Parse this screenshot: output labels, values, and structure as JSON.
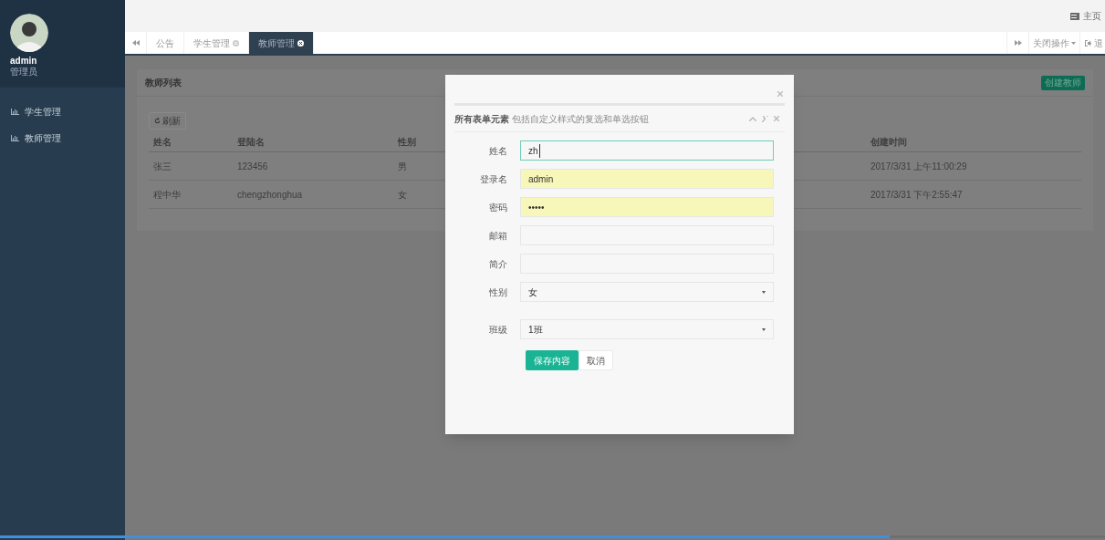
{
  "sidebar": {
    "user": {
      "name": "admin",
      "role": "管理员"
    },
    "items": [
      {
        "label": "学生管理",
        "selected": false
      },
      {
        "label": "教师管理",
        "selected": false
      }
    ]
  },
  "header": {
    "home_link": "主页"
  },
  "tabs": [
    {
      "label": "公告",
      "closable": false,
      "selected": false
    },
    {
      "label": "学生管理",
      "closable": true,
      "selected": false
    },
    {
      "label": "教师管理",
      "closable": true,
      "selected": true
    }
  ],
  "tab_tools": {
    "close_menu": "关闭操作",
    "logout": "退"
  },
  "panel": {
    "title": "教师列表",
    "create_button": "创建教师",
    "refresh_button": "刷新",
    "columns": [
      "姓名",
      "登陆名",
      "性别",
      "创建时间"
    ],
    "rows": [
      [
        "张三",
        "123456",
        "男",
        "2017/3/31 上午11:00:29"
      ],
      [
        "程中华",
        "chengzhonghua",
        "女",
        "2017/3/31 下午2:55:47"
      ]
    ]
  },
  "dialog": {
    "title": "所有表单元素",
    "subtitle": "包括自定义样式的复选和单选按钮",
    "fields": [
      {
        "label": "姓名",
        "kind": "text",
        "value": "zh",
        "focused": true,
        "autofilled": false
      },
      {
        "label": "登录名",
        "kind": "text",
        "value": "admin",
        "focused": false,
        "autofilled": true
      },
      {
        "label": "密码",
        "kind": "password",
        "value": "•••••",
        "focused": false,
        "autofilled": true
      },
      {
        "label": "邮箱",
        "kind": "text",
        "focused": false,
        "autofilled": false
      },
      {
        "label": "简介",
        "kind": "text",
        "focused": false,
        "autofilled": false
      },
      {
        "label": "性别",
        "kind": "select",
        "value": "女",
        "focused": false,
        "autofilled": false
      },
      {
        "label": "班级",
        "kind": "select",
        "value": "1班",
        "focused": false,
        "autofilled": false
      }
    ],
    "save_button": "保存内容",
    "cancel_button": "取消"
  },
  "loading_bar": {
    "level": 0.805
  }
}
